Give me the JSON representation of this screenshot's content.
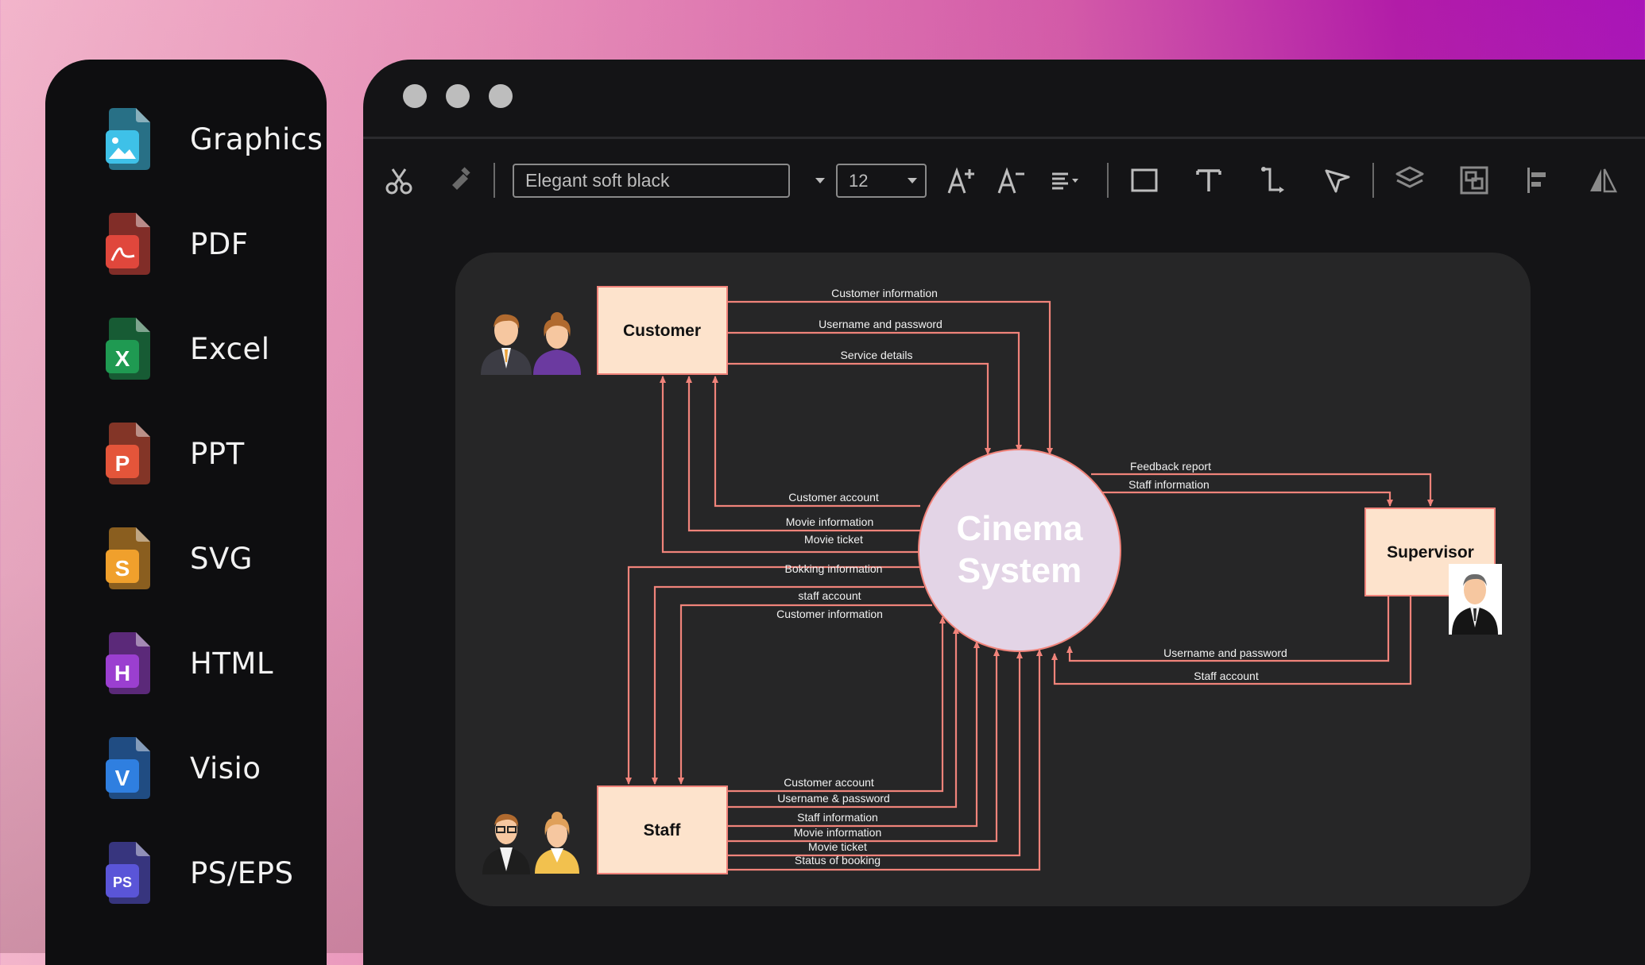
{
  "formats": [
    {
      "label": "Graphics",
      "icon": "image-icon",
      "color": "#3ec1e8",
      "letter": ""
    },
    {
      "label": "PDF",
      "icon": "pdf-icon",
      "color": "#e0473c",
      "letter": ""
    },
    {
      "label": "Excel",
      "icon": "excel-icon",
      "color": "#1f9a52",
      "letter": "X"
    },
    {
      "label": "PPT",
      "icon": "ppt-icon",
      "color": "#e4553a",
      "letter": "P"
    },
    {
      "label": "SVG",
      "icon": "svg-icon",
      "color": "#f0a02c",
      "letter": "S"
    },
    {
      "label": "HTML",
      "icon": "html-icon",
      "color": "#9b3fd0",
      "letter": "H"
    },
    {
      "label": "Visio",
      "icon": "visio-icon",
      "color": "#2f7fe0",
      "letter": "V"
    },
    {
      "label": "PS/EPS",
      "icon": "ps-icon",
      "color": "#5a55d8",
      "letter": "PS"
    }
  ],
  "toolbar": {
    "font_name": "Elegant soft black",
    "font_size": "12"
  },
  "diagram": {
    "center": "Cinema System",
    "center_line1": "Cinema",
    "center_line2": "System",
    "customer": "Customer",
    "staff": "Staff",
    "supervisor": "Supervisor",
    "flows": {
      "customer_information_top": "Customer information",
      "username_and_password_top": "Username and password",
      "service_details": "Service details",
      "customer_account_left": "Customer account",
      "movie_information_left": "Movie information",
      "movie_ticket_left": "Movie ticket",
      "bokking_information": "Bokking information",
      "staff_account_lower": "staff account",
      "customer_information_lower": "Customer information",
      "feedback_report": "Feedback report",
      "staff_information_right": "Staff information",
      "username_and_password_right": "Username and password",
      "staff_account_right": "Staff account",
      "customer_account_bottom": "Customer account",
      "username_password_bottom": "Username & password",
      "staff_information_bottom": "Staff information",
      "movie_information_bottom": "Movie information",
      "movie_ticket_bottom": "Movie ticket",
      "status_of_booking": "Status of booking"
    }
  },
  "colors": {
    "flow_line": "#f0837a",
    "entity_fill": "#fde3cc",
    "process_fill": "#e3d4e6"
  }
}
